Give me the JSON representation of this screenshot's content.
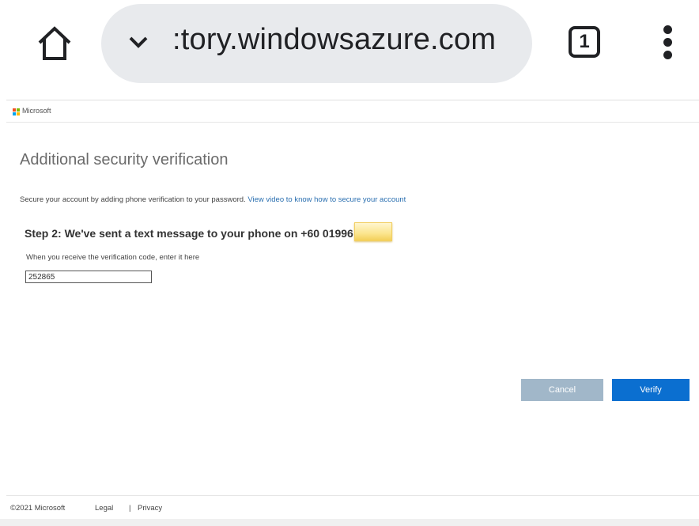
{
  "browser": {
    "url_text": ":tory.windowsazure.com",
    "tab_count": "1",
    "icons": {
      "home": "home-icon",
      "chevron": "chevron-down-icon",
      "menu": "more-vert-icon"
    }
  },
  "header": {
    "brand": "Microsoft",
    "logo_colors": [
      "#f25022",
      "#7fba00",
      "#00a4ef",
      "#ffb900"
    ]
  },
  "main": {
    "title": "Additional security verification",
    "intro_text": "Secure your account by adding phone verification to your password.",
    "intro_link": "View video to know how to secure your account",
    "step_heading": "Step 2: We've sent a text message to your phone on +60 01996",
    "code_label": "When you receive the verification code, enter it here",
    "code_value": "252865"
  },
  "actions": {
    "cancel_label": "Cancel",
    "verify_label": "Verify",
    "cancel_color": "#a1b7c9",
    "verify_color": "#0b6fd0"
  },
  "footer": {
    "copyright": "©2021 Microsoft",
    "legal": "Legal",
    "separator": "|",
    "privacy": "Privacy"
  }
}
